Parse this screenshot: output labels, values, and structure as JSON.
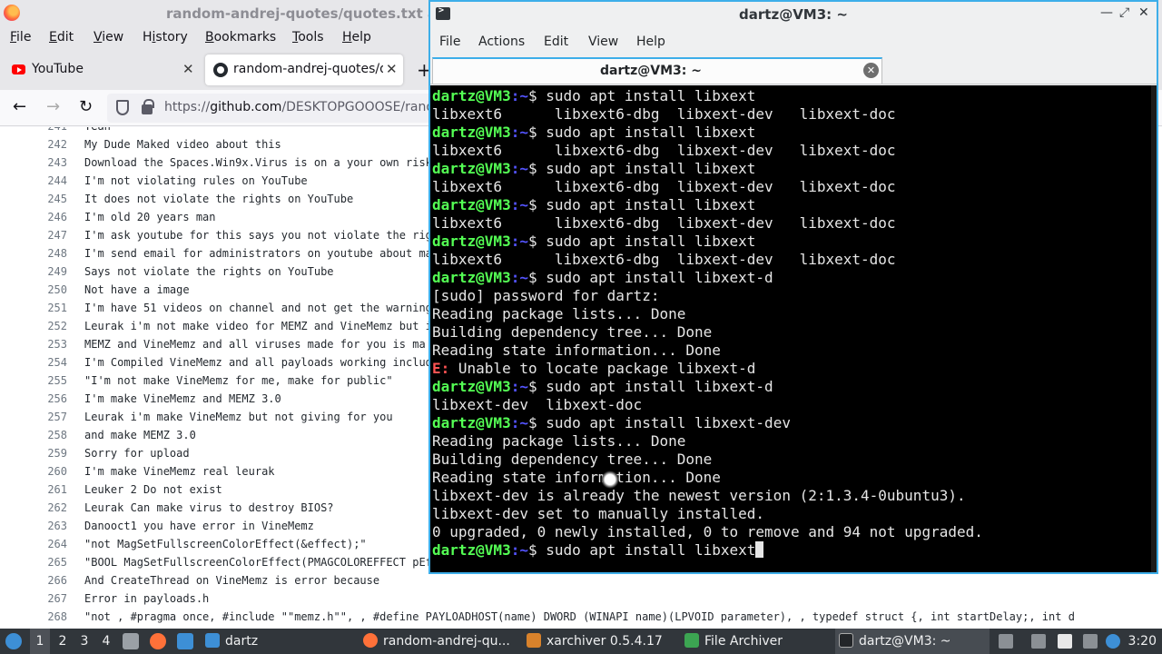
{
  "browser": {
    "title": "random-andrej-quotes/quotes.txt a",
    "menu": [
      {
        "label": "File",
        "mnemonic_index": 0
      },
      {
        "label": "Edit",
        "mnemonic_index": 0
      },
      {
        "label": "View",
        "mnemonic_index": 0
      },
      {
        "label": "History",
        "mnemonic_index": 1
      },
      {
        "label": "Bookmarks",
        "mnemonic_index": 0
      },
      {
        "label": "Tools",
        "mnemonic_index": 0
      },
      {
        "label": "Help",
        "mnemonic_index": 0
      }
    ],
    "tabs": {
      "youtube": {
        "label": "YouTube",
        "close": "✕"
      },
      "github": {
        "label": "random-andrej-quotes/qu",
        "close": "✕"
      },
      "new_tab": "+"
    },
    "nav": {
      "back": "←",
      "forward": "→",
      "reload": "↻"
    },
    "url": {
      "prefix": "https://",
      "host": "github.com",
      "path": "/DESKTOPGOOOSE/rand"
    },
    "code_lines": [
      {
        "n": "241",
        "t": "Yeah"
      },
      {
        "n": "242",
        "t": "My Dude Maked video about this"
      },
      {
        "n": "243",
        "t": "Download the Spaces.Win9x.Virus is on a your own risk"
      },
      {
        "n": "244",
        "t": "I'm not violating rules on YouTube"
      },
      {
        "n": "245",
        "t": "It does not violate the rights on YouTube"
      },
      {
        "n": "246",
        "t": "I'm old 20 years man"
      },
      {
        "n": "247",
        "t": "I'm ask youtube for this says you not violate the rig"
      },
      {
        "n": "248",
        "t": "I'm send email for administrators on youtube about ma"
      },
      {
        "n": "249",
        "t": "Says not violate the rights on YouTube"
      },
      {
        "n": "250",
        "t": "Not have a image"
      },
      {
        "n": "251",
        "t": "I'm have 51 videos on channel and not get the warning"
      },
      {
        "n": "252",
        "t": "Leurak i'm not make video for MEMZ and VineMemz but i"
      },
      {
        "n": "253",
        "t": "MEMZ and VineMemz and all viruses  made for you is ma"
      },
      {
        "n": "254",
        "t": "I'm Compiled VineMemz and all payloads working includ"
      },
      {
        "n": "255",
        "t": "\"I'm not make VineMemz for me, make for public\""
      },
      {
        "n": "256",
        "t": "I'm make VineMemz and MEMZ 3.0"
      },
      {
        "n": "257",
        "t": "Leurak i'm make VineMemz but not giving for you"
      },
      {
        "n": "258",
        "t": "and make MEMZ 3.0"
      },
      {
        "n": "259",
        "t": "Sorry for upload"
      },
      {
        "n": "260",
        "t": "I'm make VineMemz real leurak"
      },
      {
        "n": "261",
        "t": "Leuker 2 Do not exist"
      },
      {
        "n": "262",
        "t": "Leurak Can make virus to destroy BIOS?"
      },
      {
        "n": "263",
        "t": "Danooct1 you have error in VineMemz"
      },
      {
        "n": "264",
        "t": "\"not MagSetFullscreenColorEffect(&effect);\""
      },
      {
        "n": "265",
        "t": "\"BOOL MagSetFullscreenColorEffect(PMAGCOLOREFFECT pEf"
      },
      {
        "n": "266",
        "t": "And CreateThread on VineMemz is error because"
      },
      {
        "n": "267",
        "t": "Error in payloads.h"
      },
      {
        "n": "268",
        "t": "\"not , #pragma once, #include \"\"memz.h\"\", , #define PAYLOADHOST(name) DWORD (WINAPI name)(LPVOID parameter), , typedef struct {,     int startDelay;,     int d"
      }
    ]
  },
  "terminal": {
    "window_title": "dartz@VM3: ~",
    "controls": {
      "minimize": "—",
      "maximize": "⤢",
      "close": "✕"
    },
    "menu": [
      "File",
      "Actions",
      "Edit",
      "View",
      "Help"
    ],
    "tab_label": "dartz@VM3: ~",
    "tab_close": "✕",
    "prompt_user": "dartz@VM3",
    "prompt_path": ":~",
    "prompt_sym": "$ ",
    "lines": [
      {
        "kind": "cmd",
        "text": "sudo apt install libxext"
      },
      {
        "kind": "out",
        "text": "libxext6      libxext6-dbg  libxext-dev   libxext-doc"
      },
      {
        "kind": "cmd",
        "text": "sudo apt install libxext"
      },
      {
        "kind": "out",
        "text": "libxext6      libxext6-dbg  libxext-dev   libxext-doc"
      },
      {
        "kind": "cmd",
        "text": "sudo apt install libxext"
      },
      {
        "kind": "out",
        "text": "libxext6      libxext6-dbg  libxext-dev   libxext-doc"
      },
      {
        "kind": "cmd",
        "text": "sudo apt install libxext"
      },
      {
        "kind": "out",
        "text": "libxext6      libxext6-dbg  libxext-dev   libxext-doc"
      },
      {
        "kind": "cmd",
        "text": "sudo apt install libxext"
      },
      {
        "kind": "out",
        "text": "libxext6      libxext6-dbg  libxext-dev   libxext-doc"
      },
      {
        "kind": "cmd",
        "text": "sudo apt install libxext-d"
      },
      {
        "kind": "out",
        "text": "[sudo] password for dartz:"
      },
      {
        "kind": "out",
        "text": "Reading package lists... Done"
      },
      {
        "kind": "out",
        "text": "Building dependency tree... Done"
      },
      {
        "kind": "out",
        "text": "Reading state information... Done"
      },
      {
        "kind": "err",
        "prefix": "E:",
        "text": " Unable to locate package libxext-d"
      },
      {
        "kind": "cmd",
        "text": "sudo apt install libxext-d"
      },
      {
        "kind": "out",
        "text": "libxext-dev  libxext-doc"
      },
      {
        "kind": "cmd",
        "text": "sudo apt install libxext-dev"
      },
      {
        "kind": "out",
        "text": "Reading package lists... Done"
      },
      {
        "kind": "out",
        "text": "Building dependency tree... Done"
      },
      {
        "kind": "out",
        "text": "Reading state information... Done"
      },
      {
        "kind": "out",
        "text": "libxext-dev is already the newest version (2:1.3.4-0ubuntu3)."
      },
      {
        "kind": "out",
        "text": "libxext-dev set to manually installed."
      },
      {
        "kind": "out",
        "text": "0 upgraded, 0 newly installed, 0 to remove and 94 not upgraded."
      },
      {
        "kind": "cmd",
        "text": "sudo apt install libxext",
        "cursor": true
      }
    ],
    "colors": {
      "prompt_user": "#54ff54",
      "prompt_path": "#5454ff",
      "error": "#ff5454",
      "accent": "#3daee9"
    }
  },
  "taskbar": {
    "workspaces": [
      "1",
      "2",
      "3",
      "4"
    ],
    "active_workspace": "1",
    "launchers": [
      "files-icon",
      "firefox-icon",
      "desktop-icon"
    ],
    "tasks": [
      {
        "label": "dartz",
        "icon": "folder-icon"
      },
      {
        "label": "random-andrej-qu...",
        "icon": "firefox-icon"
      },
      {
        "label": "xarchiver 0.5.4.17",
        "icon": "xarchiver-icon"
      },
      {
        "label": "File Archiver",
        "icon": "archive-icon"
      },
      {
        "label": "dartz@VM3: ~",
        "icon": "terminal-icon"
      }
    ],
    "tray": [
      "volume-icon",
      "network-icon",
      "eject-icon",
      "clipboard-icon",
      "notes-icon",
      "monitor-icon",
      "update-icon"
    ],
    "clock": "3:20"
  }
}
